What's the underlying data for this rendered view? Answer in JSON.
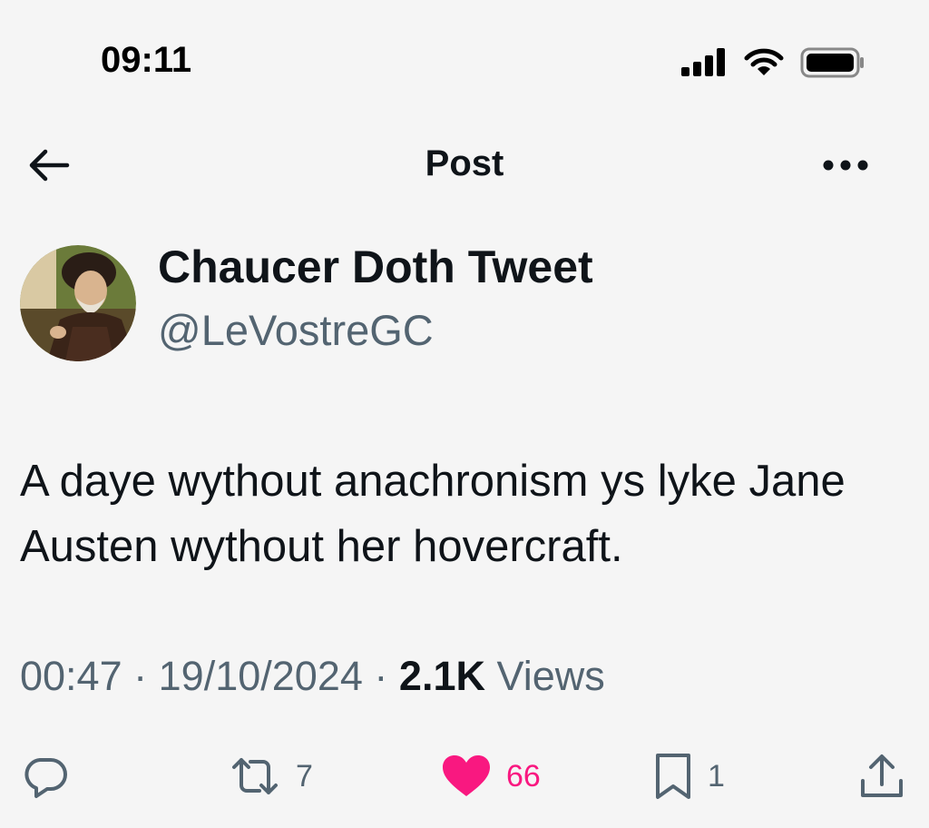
{
  "status_bar": {
    "time": "09:11"
  },
  "nav": {
    "title": "Post"
  },
  "author": {
    "display_name": "Chaucer Doth Tweet",
    "handle": "@LeVostreGC"
  },
  "tweet": {
    "text": "A daye wythout anachronism ys lyke Jane Austen wythout her hovercraft.",
    "time": "00:47",
    "date": "19/10/2024",
    "separator": "·",
    "views_count": "2.1K",
    "views_label": "Views"
  },
  "actions": {
    "reply_count": "",
    "retweet_count": "7",
    "like_count": "66",
    "bookmark_count": "1"
  },
  "icons": {
    "back": "arrow-left-icon",
    "more": "more-horizontal-icon",
    "reply": "reply-bubble-icon",
    "retweet": "retweet-icon",
    "like": "heart-icon",
    "bookmark": "bookmark-icon",
    "share": "share-icon"
  },
  "colors": {
    "background": "#f5f5f5",
    "text_primary": "#0f1419",
    "text_secondary": "#536471",
    "like_active": "#f91880"
  },
  "like_active": true
}
